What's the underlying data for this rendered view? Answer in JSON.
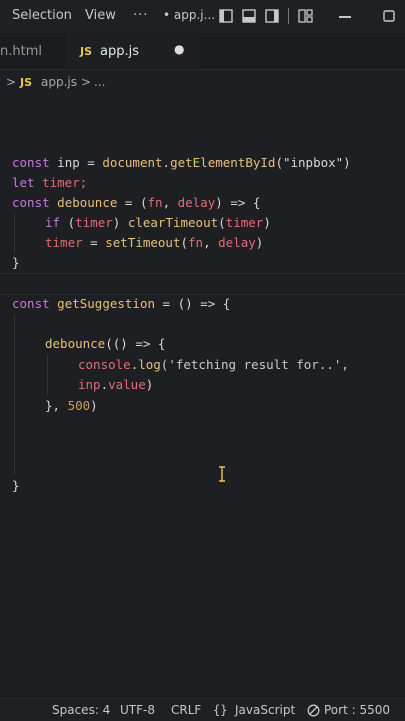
{
  "menubar": {
    "selection": "Selection",
    "view": "View",
    "more": "···",
    "title": "• app.j..."
  },
  "tabs": [
    {
      "label": "n.html"
    },
    {
      "badge": "JS",
      "label": "app.js",
      "dirty": "●"
    }
  ],
  "breadcrumb": {
    "sep1": ">",
    "badge": "JS",
    "file": "app.js",
    "sep2": ">",
    "more": "..."
  },
  "code": {
    "l1": {
      "kw": "const",
      "a": " inp = ",
      "b": "document",
      "c": ".",
      "d": "getElementById",
      "e": "(\"inpbox\")"
    },
    "l2": {
      "kw": "let",
      "a": " timer;"
    },
    "l3": {
      "kw": "const",
      "a": " ",
      "b": "debounce",
      "c": " = (",
      "d": "fn",
      "e": ", ",
      "f": "delay",
      "g": ") => {"
    },
    "l4": {
      "kw": "if",
      "a": " (",
      "b": "timer",
      "c": ") ",
      "d": "clearTimeout",
      "e": "(",
      "f": "timer",
      "g": ")"
    },
    "l5": {
      "a": "timer",
      "b": " = ",
      "c": "setTimeout",
      "d": "(",
      "e": "fn",
      "f": ", ",
      "g": "delay",
      "h": ")"
    },
    "l6": "}",
    "l7": {
      "kw": "const",
      "a": " ",
      "b": "getSuggestion",
      "c": " = () => {"
    },
    "l8": {
      "a": "debounce",
      "b": "(() => {"
    },
    "l9": {
      "a": "console",
      "b": ".",
      "c": "log",
      "d": "('fetching result for..',"
    },
    "l10": {
      "a": "inp",
      "b": ".",
      "c": "value",
      "d": ")"
    },
    "l11": {
      "a": "}, ",
      "b": "500",
      "c": ")"
    },
    "l12": "}"
  },
  "status": {
    "spaces": "Spaces: 4",
    "encoding": "UTF-8",
    "eol": "CRLF",
    "language": "JavaScript",
    "port": "Port : 5500"
  }
}
